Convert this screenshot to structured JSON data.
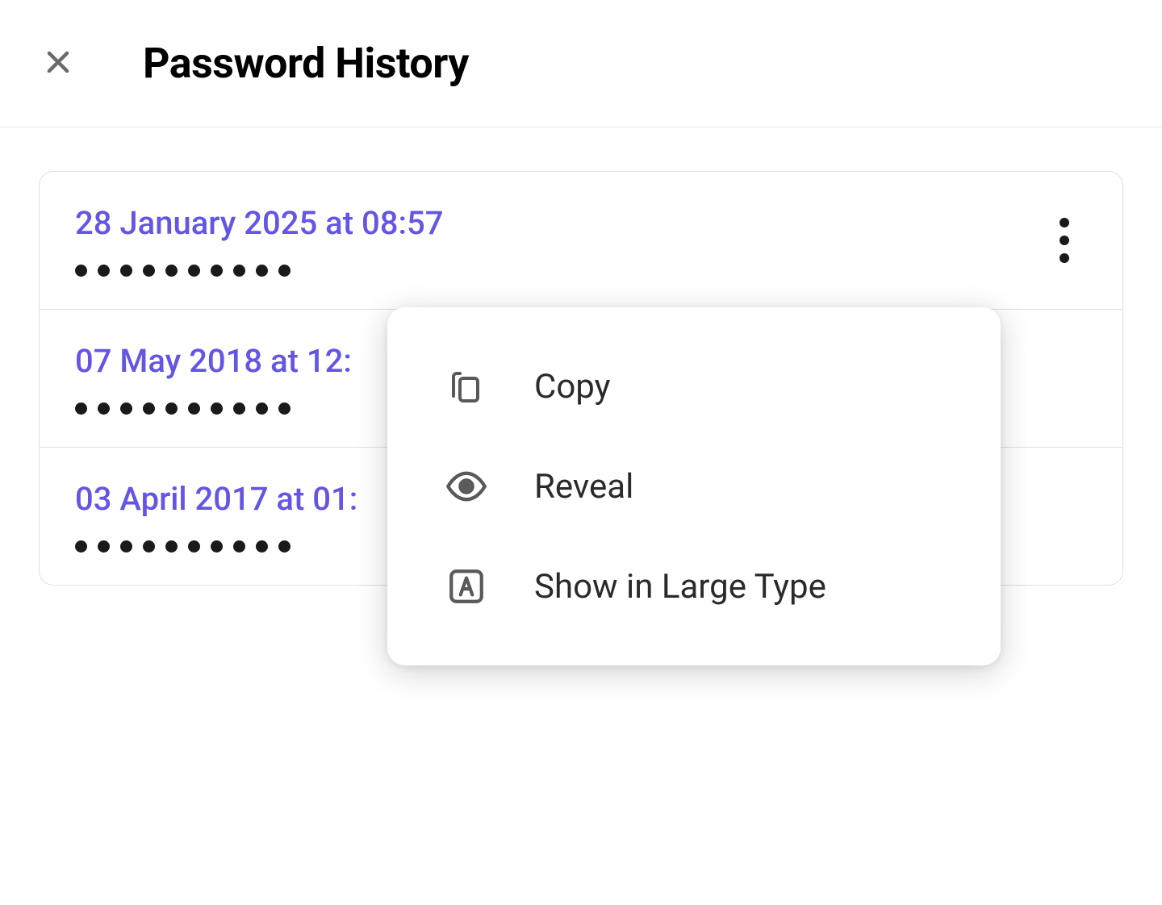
{
  "header": {
    "title": "Password History"
  },
  "history": [
    {
      "date": "28 January 2025 at 08:57",
      "dotCount": 10
    },
    {
      "date": "07 May 2018 at 12:",
      "dotCount": 10
    },
    {
      "date": "03 April 2017 at 01:",
      "dotCount": 10
    }
  ],
  "contextMenu": {
    "items": [
      {
        "icon": "copy",
        "label": "Copy"
      },
      {
        "icon": "eye",
        "label": "Reveal"
      },
      {
        "icon": "large-type",
        "label": "Show in Large Type"
      }
    ]
  }
}
